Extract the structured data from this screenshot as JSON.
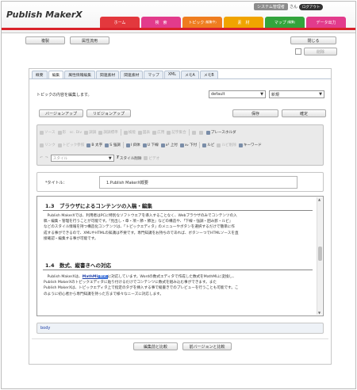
{
  "header": {
    "logo": "Publish MakerX",
    "system_badge": "システム管理者",
    "user_suffix": "さん",
    "logout": "ログアウト"
  },
  "nav": [
    {
      "label": "ホーム",
      "color": "#e3383d"
    },
    {
      "label": "検　索",
      "color": "#e23b8c"
    },
    {
      "label": "トピック",
      "sub": "(編集中)",
      "color": "#ef7d1f"
    },
    {
      "label": "素　材",
      "color": "#f0a400"
    },
    {
      "label": "マップ",
      "sub": "(編集)",
      "color": "#33a43c"
    },
    {
      "label": "データ出力",
      "color": "#e23b8c"
    }
  ],
  "toolbar": {
    "duplicate": "複製",
    "apply_attr": "属性流用",
    "close": "閉じる",
    "delete": "削除"
  },
  "tabs": [
    "概要",
    "編集",
    "属性情報編集",
    "関連素材",
    "関連素材",
    "マップ",
    "XML",
    "メモA",
    "メモB"
  ],
  "active_tab": 1,
  "editor": {
    "instruction": "トピックの内容を編集します。",
    "select_default": "default",
    "select_new": "新規",
    "version_up": "バージョンアップ",
    "revision_up": "リビジョンアップ",
    "save": "保存",
    "confirm": "確定",
    "title_label": "*タイトル：",
    "title_value": "1.Publish MakerX概要",
    "path": "body",
    "compare_edit": "編集前と比較",
    "compare_prev": "前バージョンと比較"
  },
  "editor_toolbar": {
    "row1": [
      {
        "label": "ソース",
        "on": false
      },
      {
        "label": "形　sc. Div",
        "on": false
      },
      {
        "label": "調調",
        "on": false
      },
      {
        "label": "調調標準",
        "on": false
      },
      {
        "label": "検能",
        "on": false
      },
      {
        "label": "図表",
        "on": false
      },
      {
        "label": "広用",
        "on": false
      },
      {
        "label": "記字集合",
        "on": false
      },
      {
        "label": "",
        "on": false
      },
      {
        "label": "",
        "on": false
      },
      {
        "label": "プレースホルダ",
        "on": true
      }
    ],
    "row2": [
      {
        "label": "リンク",
        "on": false
      },
      {
        "label": "トピック参照",
        "on": false
      },
      {
        "label": "B 太字",
        "on": true
      },
      {
        "label": "S 強調",
        "on": true
      },
      {
        "label": "I 斜体",
        "on": true
      },
      {
        "label": "U 下線",
        "on": true
      },
      {
        "label": "x² 上付",
        "on": true
      },
      {
        "label": "x₂ 下付",
        "on": true
      },
      {
        "label": "ルビ",
        "on": true
      },
      {
        "label": "ルビ削除",
        "on": false
      },
      {
        "label": "キーワード",
        "on": true
      }
    ],
    "row3": [
      {
        "label": "スタイル",
        "on": false
      },
      {
        "label": "スタイル削除",
        "on": true
      },
      {
        "label": "ビデオ",
        "on": false
      }
    ]
  },
  "content": {
    "h1": "1.3　ブラウザによるコンテンツの入稿・編集",
    "p1": [
      "　Publish MakerXでは、利用者はPCに特別なソフトウエアを導入することなく、Webブラウザのみでコンテンツの入",
      "稿・編集・管理を行うことが可能です。「見出し・章・項・節・節注」などの構造や、「下線・強調・囲み罫・ルビ」",
      "などのスタイル情報を持つ構造化コンテンツは、「トピックエディタ」のメニューやボタンを選択するだけで簡単に作",
      "成する事ができるので、XMLやHTMLの知識は不要です。専門知識をお持ちのであれば、ボタンーつでHTMLソースを直",
      "接確認・編集する事が可能です。"
    ],
    "h2": "1.4　数式、縦書きへの対応",
    "p2_pre": "　Publish MakerXは、",
    "p2_mathml": "MathML",
    "p2_sel": "数式",
    "p2_post": "に対応しています。Wordの数式エディタで作成した数式をMathMLに変換し、",
    "p2_rest": [
      "Publish MakerXのトピックエディタに貼り付けるだけでコンテンツに数式を組み込む事ができます。また",
      "Publish MakerXは、トピックエディタ上で指定のタグを挿入する事で縦書きでのプレビューを行うことも可能です。こ",
      "のように初心者から専門知識を持った方まで様々なニーズに対応します。"
    ]
  }
}
